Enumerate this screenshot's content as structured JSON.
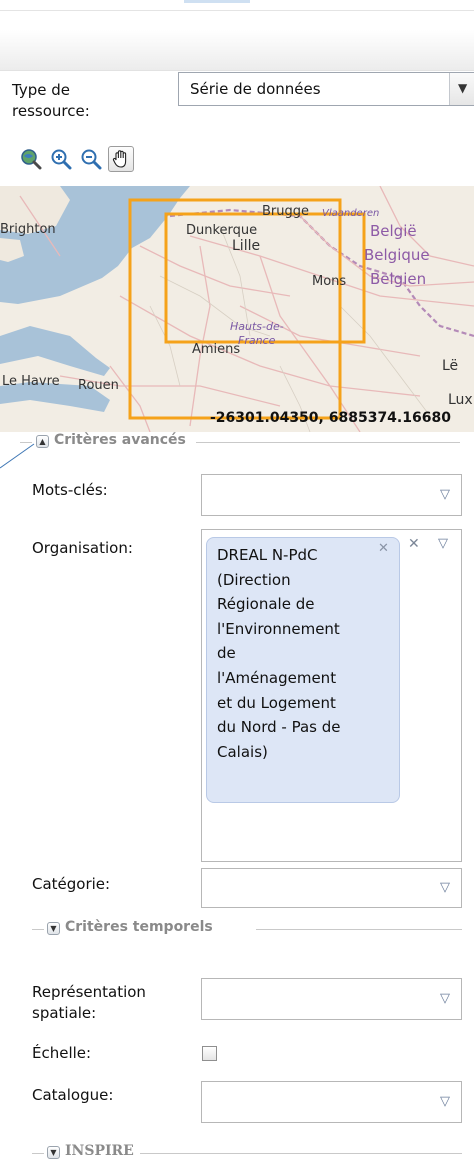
{
  "resource_type": {
    "label_line1": "Type de",
    "label_line2": "ressource:",
    "value": "Série de données"
  },
  "map": {
    "places": {
      "brugge": "Brugge",
      "vlaanderen": "Vlaanderen",
      "brighton": "Brighton",
      "dunkerque": "Dunkerque",
      "lille": "Lille",
      "belgie": "België",
      "belgique": "Belgique",
      "belgien": "Belgien",
      "mons": "Mons",
      "hauts1": "Hauts-de-",
      "hauts2": "France",
      "amiens": "Amiens",
      "le_havre": "Le Havre",
      "rouen": "Rouen",
      "lux": "Lux",
      "le": "Lë"
    },
    "coords": "-26301.04350, 6885374.16680",
    "colors": {
      "extent": "#f5a21a",
      "sea": "#a8c2d8",
      "land": "#f2ede4",
      "roads": "#e6b6b6"
    }
  },
  "advanced": {
    "title": "Critères avancés"
  },
  "keywords": {
    "label": "Mots-clés:"
  },
  "organisation": {
    "label": "Organisation:",
    "tag_lines": [
      "DREAL N-PdC",
      "(Direction",
      "Régionale de",
      "l'Environnement",
      "de",
      "l'Aménagement",
      "et du Logement",
      "du Nord - Pas de",
      "Calais)"
    ]
  },
  "category": {
    "label": "Catégorie:"
  },
  "temporal": {
    "title": "Critères temporels"
  },
  "spatial_repr": {
    "label_line1": "Représentation",
    "label_line2": "spatiale:"
  },
  "scale": {
    "label": "Échelle:"
  },
  "catalogue": {
    "label": "Catalogue:"
  },
  "inspire": {
    "title": "INSPIRE"
  }
}
